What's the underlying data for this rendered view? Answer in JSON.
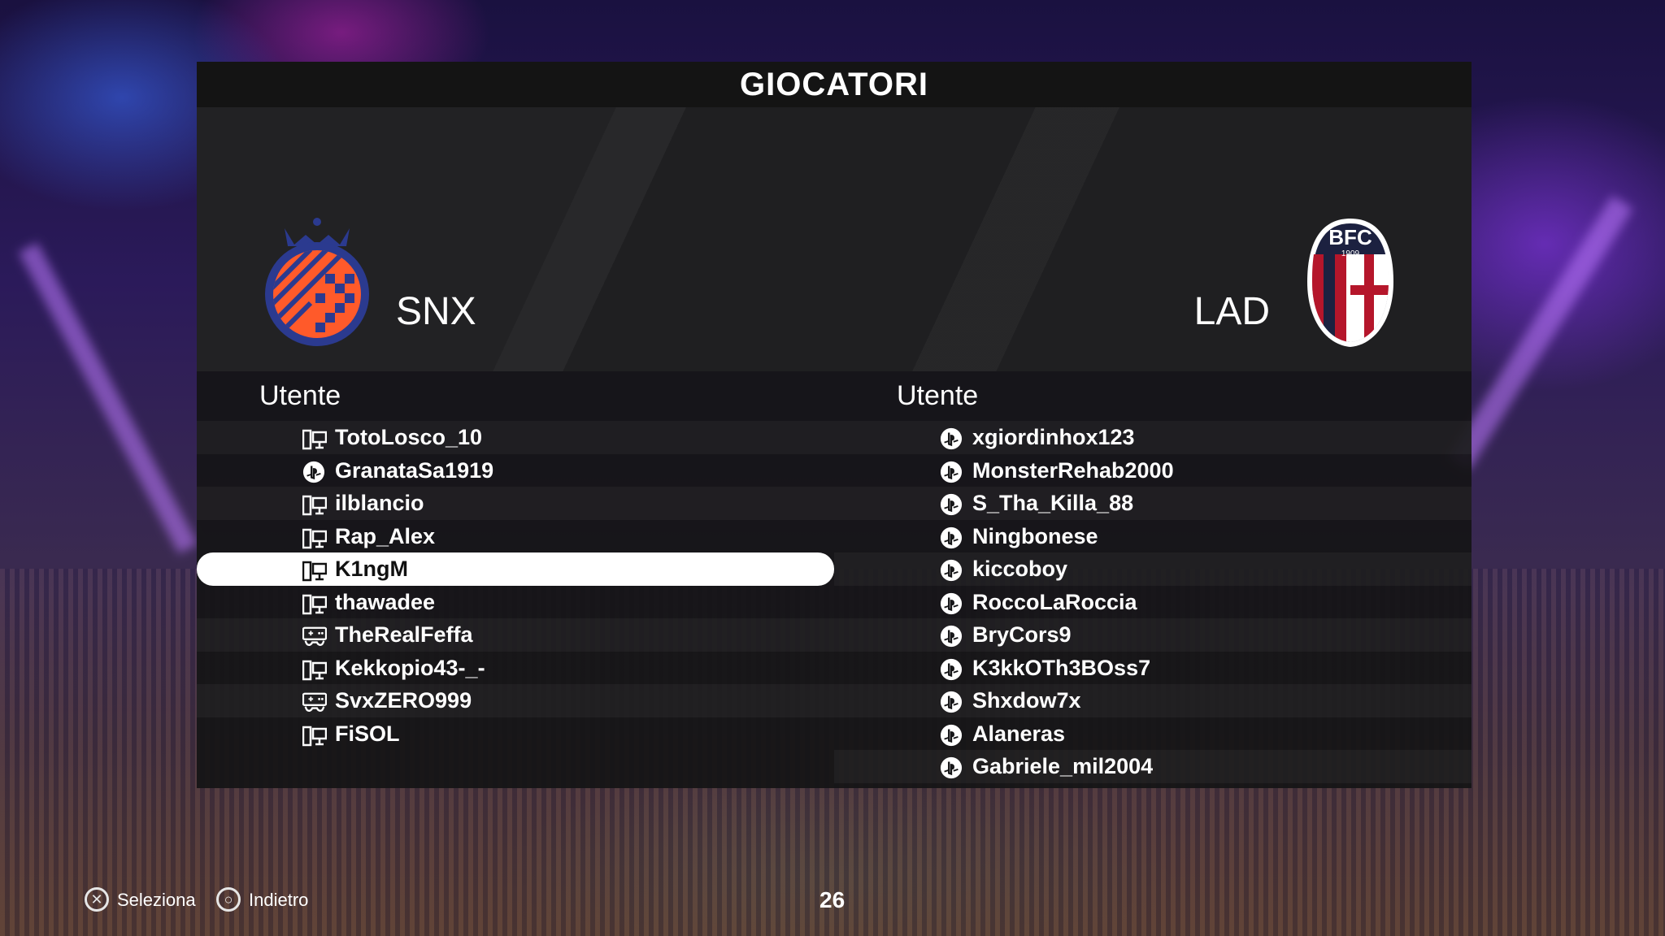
{
  "screen": {
    "title": "GIOCATORI"
  },
  "home_team": {
    "name": "SNX",
    "column_header": "Utente",
    "players": [
      {
        "name": "TotoLosco_10",
        "platform": "pc-icon"
      },
      {
        "name": "GranataSa1919",
        "platform": "playstation-icon"
      },
      {
        "name": "ilblancio",
        "platform": "pc-icon"
      },
      {
        "name": "Rap_Alex",
        "platform": "pc-icon"
      },
      {
        "name": "K1ngM",
        "platform": "pc-icon",
        "selected": true
      },
      {
        "name": "thawadee",
        "platform": "pc-icon"
      },
      {
        "name": "TheRealFeffa",
        "platform": "controller-icon"
      },
      {
        "name": "Kekkopio43-_-",
        "platform": "pc-icon"
      },
      {
        "name": "SvxZERO999",
        "platform": "controller-icon"
      },
      {
        "name": "FiSOL",
        "platform": "pc-icon"
      }
    ]
  },
  "away_team": {
    "name": "LAD",
    "column_header": "Utente",
    "crest_text": "BFC",
    "crest_year": "1909",
    "players": [
      {
        "name": "xgiordinhox123",
        "platform": "playstation-icon"
      },
      {
        "name": "MonsterRehab2000",
        "platform": "playstation-icon"
      },
      {
        "name": "S_Tha_Killa_88",
        "platform": "playstation-icon"
      },
      {
        "name": "Ningbonese",
        "platform": "playstation-icon"
      },
      {
        "name": "kiccoboy",
        "platform": "playstation-icon"
      },
      {
        "name": "RoccoLaRoccia",
        "platform": "playstation-icon"
      },
      {
        "name": "BryCors9",
        "platform": "playstation-icon"
      },
      {
        "name": "K3kkOTh3BOss7",
        "platform": "playstation-icon"
      },
      {
        "name": "Shxdow7x",
        "platform": "playstation-icon"
      },
      {
        "name": "Alaneras",
        "platform": "playstation-icon"
      },
      {
        "name": "Gabriele_mil2004",
        "platform": "playstation-icon"
      }
    ]
  },
  "footer": {
    "select_label": "Seleziona",
    "select_icon": "cross-button-icon",
    "back_label": "Indietro",
    "back_icon": "circle-button-icon",
    "timer": "26"
  },
  "colors": {
    "panel": "#141416",
    "selected_row": "#ffffff",
    "home_crest_blue": "#2b3a8f",
    "home_crest_orange": "#ff5a2a",
    "away_crest_red": "#b5162b",
    "away_crest_navy": "#1c2140"
  }
}
